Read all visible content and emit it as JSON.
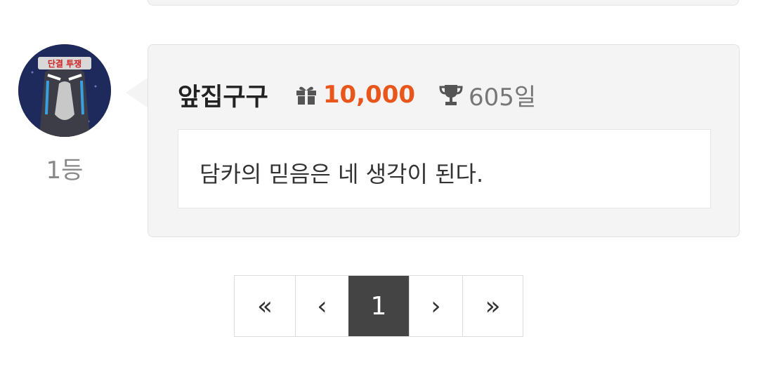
{
  "comment": {
    "username": "앞집구구",
    "gift_icon": "gift-icon",
    "points": "10,000",
    "trophy_icon": "trophy-icon",
    "days": "605일",
    "text": "담카의 믿음은 네 생각이 된다.",
    "rank": "1등",
    "avatar_text": "단결 투쟁"
  },
  "pagination": {
    "first": "«",
    "prev": "‹",
    "current": "1",
    "next": "›",
    "last": "»"
  },
  "colors": {
    "points": "#e8561c",
    "active_page": "#444444",
    "card_bg": "#f4f4f4"
  }
}
